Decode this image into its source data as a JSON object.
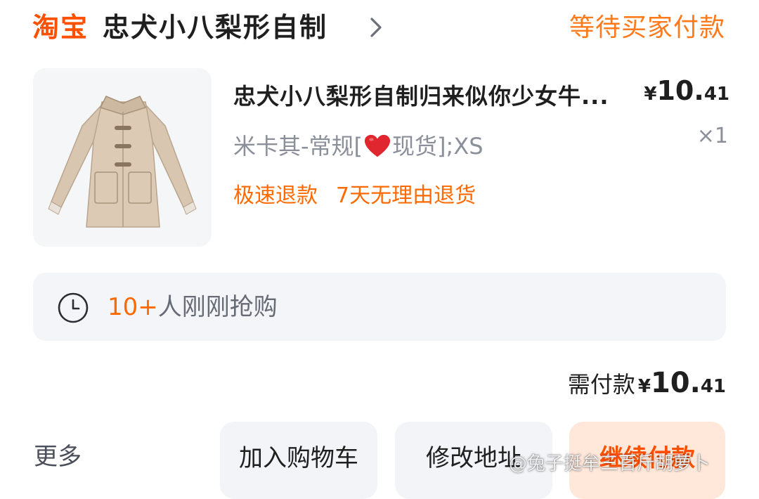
{
  "header": {
    "platform": "淘宝",
    "shop_name": "忠犬小八梨形自制",
    "order_status": "等待买家付款"
  },
  "product": {
    "title": "忠犬小八梨形自制归来似你少女牛...",
    "price": {
      "currency": "¥",
      "integer": "10.",
      "decimal": "41"
    },
    "sku_prefix": "米卡其-常规[",
    "sku_suffix": "现货];XS",
    "quantity": "×1",
    "tags": [
      "极速退款",
      "7天无理由退货"
    ],
    "image_icon": "coat-image"
  },
  "notice": {
    "icon": "clock-icon",
    "count": "10+",
    "text": "人刚刚抢购"
  },
  "total": {
    "label": "需付款",
    "currency": "¥",
    "integer": "10.",
    "decimal": "41"
  },
  "actions": {
    "more": "更多",
    "add_to_cart": "加入购物车",
    "modify_address": "修改地址",
    "continue_payment": "继续付款"
  },
  "watermark": "@兔子挺牟三百斤胡萝卜",
  "colors": {
    "brand": "#ff5000",
    "accent": "#ff6a00",
    "status": "#ff7a1a",
    "muted": "#8a8f99",
    "panel": "#f3f5f8",
    "pay_button_bg": "#ffe8da"
  }
}
